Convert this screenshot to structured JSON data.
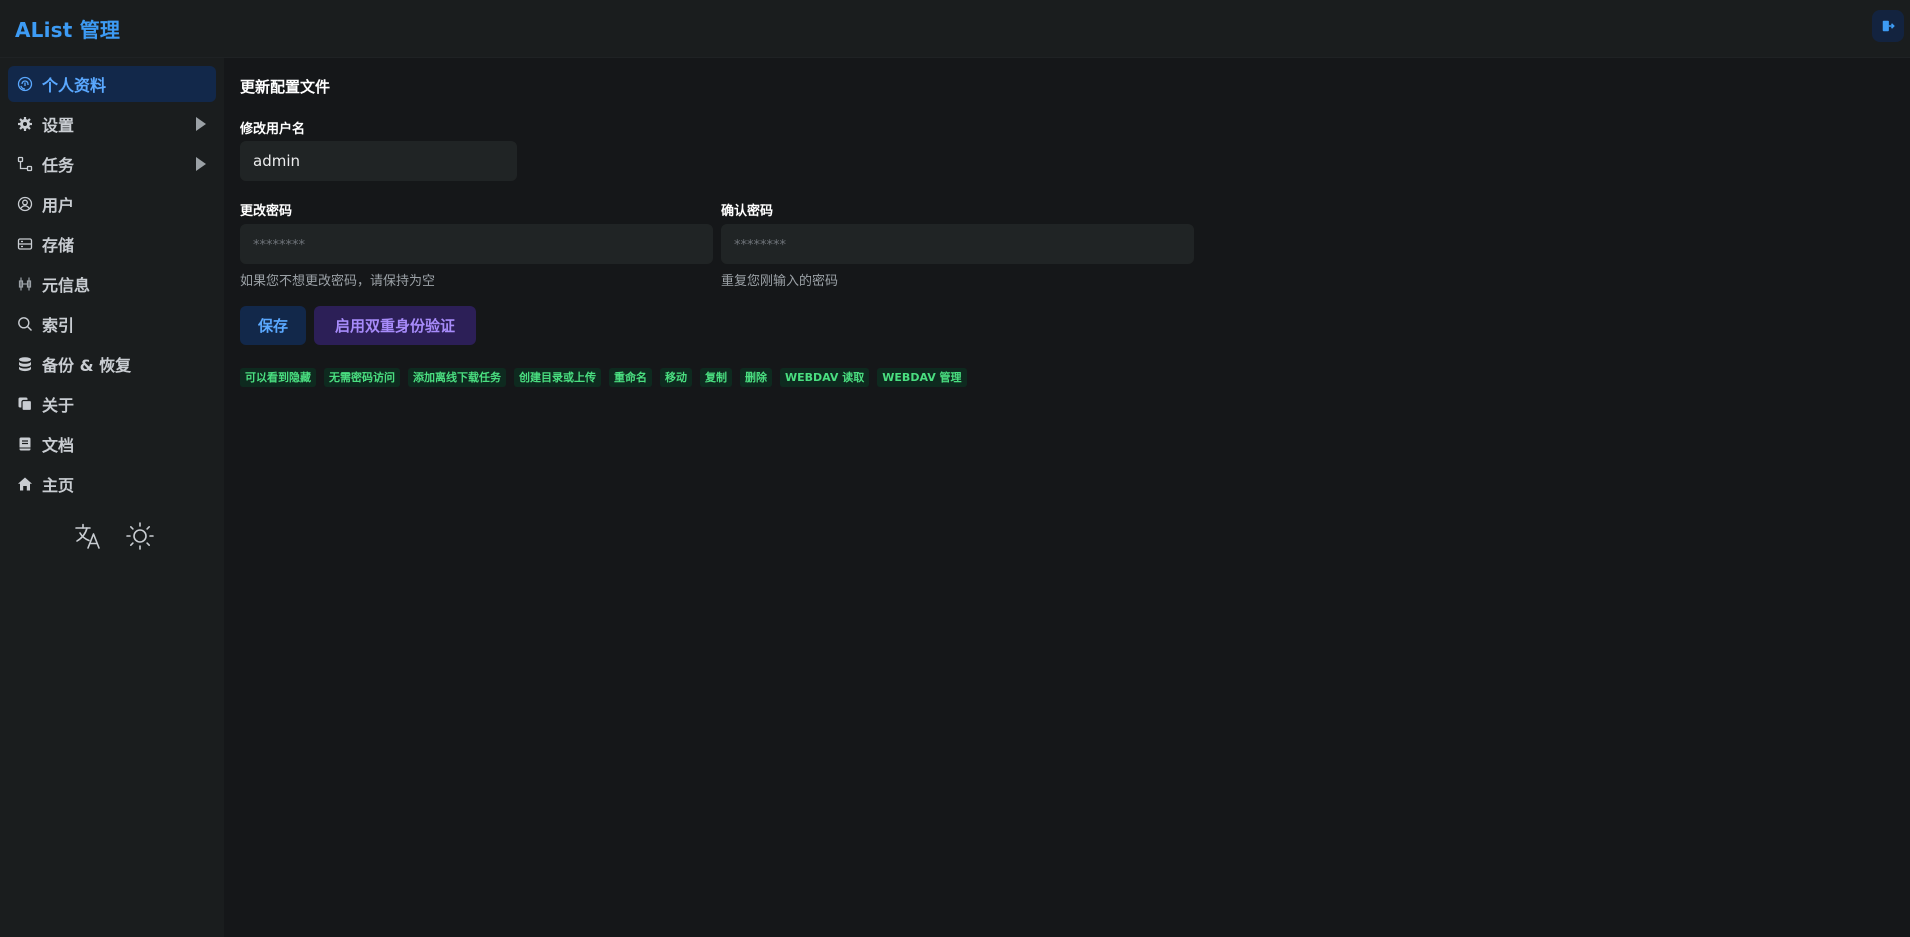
{
  "header": {
    "brand": "AList 管理",
    "logout_icon": "logout-icon"
  },
  "sidebar": {
    "items": [
      {
        "label": "个人资料",
        "icon": "fingerprint-icon",
        "active": true,
        "expandable": false
      },
      {
        "label": "设置",
        "icon": "gear-icon",
        "active": false,
        "expandable": true
      },
      {
        "label": "任务",
        "icon": "tasks-icon",
        "active": false,
        "expandable": true
      },
      {
        "label": "用户",
        "icon": "user-icon",
        "active": false,
        "expandable": false
      },
      {
        "label": "存储",
        "icon": "storage-icon",
        "active": false,
        "expandable": false
      },
      {
        "label": "元信息",
        "icon": "metadata-icon",
        "active": false,
        "expandable": false
      },
      {
        "label": "索引",
        "icon": "search-icon",
        "active": false,
        "expandable": false
      },
      {
        "label": "备份 & 恢复",
        "icon": "database-icon",
        "active": false,
        "expandable": false
      },
      {
        "label": "关于",
        "icon": "copy-icon",
        "active": false,
        "expandable": false
      },
      {
        "label": "文档",
        "icon": "book-icon",
        "active": false,
        "expandable": false
      },
      {
        "label": "主页",
        "icon": "home-icon",
        "active": false,
        "expandable": false
      }
    ],
    "tools": [
      "translate-icon",
      "sun-icon"
    ]
  },
  "main": {
    "title": "更新配置文件",
    "username": {
      "label": "修改用户名",
      "value": "admin"
    },
    "password": {
      "label": "更改密码",
      "placeholder": "********",
      "helper": "如果您不想更改密码，请保持为空"
    },
    "confirm_password": {
      "label": "确认密码",
      "placeholder": "********",
      "helper": "重复您刚输入的密码"
    },
    "buttons": {
      "save": "保存",
      "enable_2fa": "启用双重身份验证"
    },
    "permissions": [
      "可以看到隐藏",
      "无需密码访问",
      "添加离线下载任务",
      "创建目录或上传",
      "重命名",
      "移动",
      "复制",
      "删除",
      "WEBDAV 读取",
      "WEBDAV 管理"
    ]
  },
  "colors": {
    "accent": "#3d9bf4",
    "permission_text": "#4ade80",
    "permission_bg": "#0e2a1f",
    "purple": "#a78bfa"
  }
}
